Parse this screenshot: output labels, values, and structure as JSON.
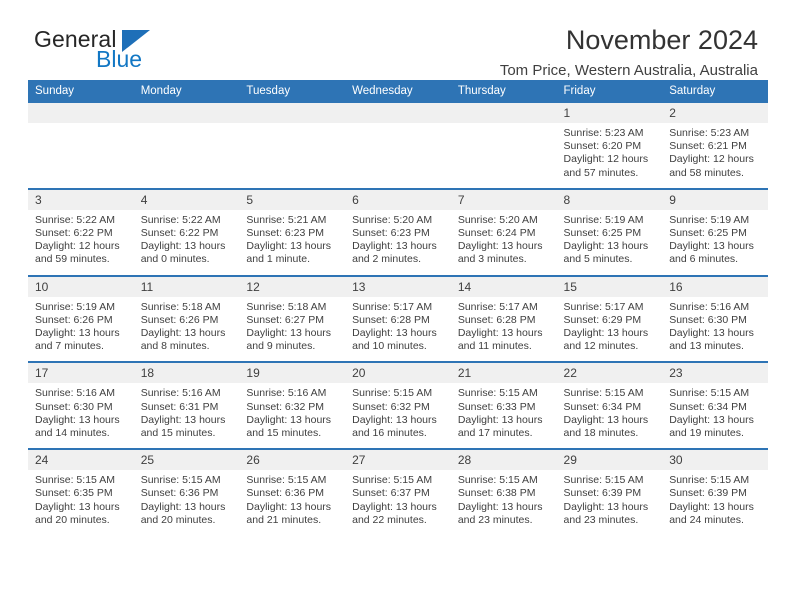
{
  "brand": {
    "word1": "General",
    "word2": "Blue",
    "triangle_icon": "blue-triangle-logo-mark",
    "accent_color": "#1e6fb8"
  },
  "header": {
    "title": "November 2024",
    "subtitle": "Tom Price, Western Australia, Australia"
  },
  "theme": {
    "header_blue": "#2e74b5",
    "daynum_band": "#f0f0f0",
    "text": "#404040"
  },
  "calendar": {
    "weekday_headers": [
      "Sunday",
      "Monday",
      "Tuesday",
      "Wednesday",
      "Thursday",
      "Friday",
      "Saturday"
    ],
    "labels": {
      "sunrise": "Sunrise:",
      "sunset": "Sunset:",
      "daylight": "Daylight:"
    },
    "weeks": [
      [
        {
          "day": ""
        },
        {
          "day": ""
        },
        {
          "day": ""
        },
        {
          "day": ""
        },
        {
          "day": ""
        },
        {
          "day": "1",
          "sunrise": "Sunrise: 5:23 AM",
          "sunset": "Sunset: 6:20 PM",
          "daylight1": "Daylight: 12 hours",
          "daylight2": "and 57 minutes."
        },
        {
          "day": "2",
          "sunrise": "Sunrise: 5:23 AM",
          "sunset": "Sunset: 6:21 PM",
          "daylight1": "Daylight: 12 hours",
          "daylight2": "and 58 minutes."
        }
      ],
      [
        {
          "day": "3",
          "sunrise": "Sunrise: 5:22 AM",
          "sunset": "Sunset: 6:22 PM",
          "daylight1": "Daylight: 12 hours",
          "daylight2": "and 59 minutes."
        },
        {
          "day": "4",
          "sunrise": "Sunrise: 5:22 AM",
          "sunset": "Sunset: 6:22 PM",
          "daylight1": "Daylight: 13 hours",
          "daylight2": "and 0 minutes."
        },
        {
          "day": "5",
          "sunrise": "Sunrise: 5:21 AM",
          "sunset": "Sunset: 6:23 PM",
          "daylight1": "Daylight: 13 hours",
          "daylight2": "and 1 minute."
        },
        {
          "day": "6",
          "sunrise": "Sunrise: 5:20 AM",
          "sunset": "Sunset: 6:23 PM",
          "daylight1": "Daylight: 13 hours",
          "daylight2": "and 2 minutes."
        },
        {
          "day": "7",
          "sunrise": "Sunrise: 5:20 AM",
          "sunset": "Sunset: 6:24 PM",
          "daylight1": "Daylight: 13 hours",
          "daylight2": "and 3 minutes."
        },
        {
          "day": "8",
          "sunrise": "Sunrise: 5:19 AM",
          "sunset": "Sunset: 6:25 PM",
          "daylight1": "Daylight: 13 hours",
          "daylight2": "and 5 minutes."
        },
        {
          "day": "9",
          "sunrise": "Sunrise: 5:19 AM",
          "sunset": "Sunset: 6:25 PM",
          "daylight1": "Daylight: 13 hours",
          "daylight2": "and 6 minutes."
        }
      ],
      [
        {
          "day": "10",
          "sunrise": "Sunrise: 5:19 AM",
          "sunset": "Sunset: 6:26 PM",
          "daylight1": "Daylight: 13 hours",
          "daylight2": "and 7 minutes."
        },
        {
          "day": "11",
          "sunrise": "Sunrise: 5:18 AM",
          "sunset": "Sunset: 6:26 PM",
          "daylight1": "Daylight: 13 hours",
          "daylight2": "and 8 minutes."
        },
        {
          "day": "12",
          "sunrise": "Sunrise: 5:18 AM",
          "sunset": "Sunset: 6:27 PM",
          "daylight1": "Daylight: 13 hours",
          "daylight2": "and 9 minutes."
        },
        {
          "day": "13",
          "sunrise": "Sunrise: 5:17 AM",
          "sunset": "Sunset: 6:28 PM",
          "daylight1": "Daylight: 13 hours",
          "daylight2": "and 10 minutes."
        },
        {
          "day": "14",
          "sunrise": "Sunrise: 5:17 AM",
          "sunset": "Sunset: 6:28 PM",
          "daylight1": "Daylight: 13 hours",
          "daylight2": "and 11 minutes."
        },
        {
          "day": "15",
          "sunrise": "Sunrise: 5:17 AM",
          "sunset": "Sunset: 6:29 PM",
          "daylight1": "Daylight: 13 hours",
          "daylight2": "and 12 minutes."
        },
        {
          "day": "16",
          "sunrise": "Sunrise: 5:16 AM",
          "sunset": "Sunset: 6:30 PM",
          "daylight1": "Daylight: 13 hours",
          "daylight2": "and 13 minutes."
        }
      ],
      [
        {
          "day": "17",
          "sunrise": "Sunrise: 5:16 AM",
          "sunset": "Sunset: 6:30 PM",
          "daylight1": "Daylight: 13 hours",
          "daylight2": "and 14 minutes."
        },
        {
          "day": "18",
          "sunrise": "Sunrise: 5:16 AM",
          "sunset": "Sunset: 6:31 PM",
          "daylight1": "Daylight: 13 hours",
          "daylight2": "and 15 minutes."
        },
        {
          "day": "19",
          "sunrise": "Sunrise: 5:16 AM",
          "sunset": "Sunset: 6:32 PM",
          "daylight1": "Daylight: 13 hours",
          "daylight2": "and 15 minutes."
        },
        {
          "day": "20",
          "sunrise": "Sunrise: 5:15 AM",
          "sunset": "Sunset: 6:32 PM",
          "daylight1": "Daylight: 13 hours",
          "daylight2": "and 16 minutes."
        },
        {
          "day": "21",
          "sunrise": "Sunrise: 5:15 AM",
          "sunset": "Sunset: 6:33 PM",
          "daylight1": "Daylight: 13 hours",
          "daylight2": "and 17 minutes."
        },
        {
          "day": "22",
          "sunrise": "Sunrise: 5:15 AM",
          "sunset": "Sunset: 6:34 PM",
          "daylight1": "Daylight: 13 hours",
          "daylight2": "and 18 minutes."
        },
        {
          "day": "23",
          "sunrise": "Sunrise: 5:15 AM",
          "sunset": "Sunset: 6:34 PM",
          "daylight1": "Daylight: 13 hours",
          "daylight2": "and 19 minutes."
        }
      ],
      [
        {
          "day": "24",
          "sunrise": "Sunrise: 5:15 AM",
          "sunset": "Sunset: 6:35 PM",
          "daylight1": "Daylight: 13 hours",
          "daylight2": "and 20 minutes."
        },
        {
          "day": "25",
          "sunrise": "Sunrise: 5:15 AM",
          "sunset": "Sunset: 6:36 PM",
          "daylight1": "Daylight: 13 hours",
          "daylight2": "and 20 minutes."
        },
        {
          "day": "26",
          "sunrise": "Sunrise: 5:15 AM",
          "sunset": "Sunset: 6:36 PM",
          "daylight1": "Daylight: 13 hours",
          "daylight2": "and 21 minutes."
        },
        {
          "day": "27",
          "sunrise": "Sunrise: 5:15 AM",
          "sunset": "Sunset: 6:37 PM",
          "daylight1": "Daylight: 13 hours",
          "daylight2": "and 22 minutes."
        },
        {
          "day": "28",
          "sunrise": "Sunrise: 5:15 AM",
          "sunset": "Sunset: 6:38 PM",
          "daylight1": "Daylight: 13 hours",
          "daylight2": "and 23 minutes."
        },
        {
          "day": "29",
          "sunrise": "Sunrise: 5:15 AM",
          "sunset": "Sunset: 6:39 PM",
          "daylight1": "Daylight: 13 hours",
          "daylight2": "and 23 minutes."
        },
        {
          "day": "30",
          "sunrise": "Sunrise: 5:15 AM",
          "sunset": "Sunset: 6:39 PM",
          "daylight1": "Daylight: 13 hours",
          "daylight2": "and 24 minutes."
        }
      ]
    ]
  }
}
